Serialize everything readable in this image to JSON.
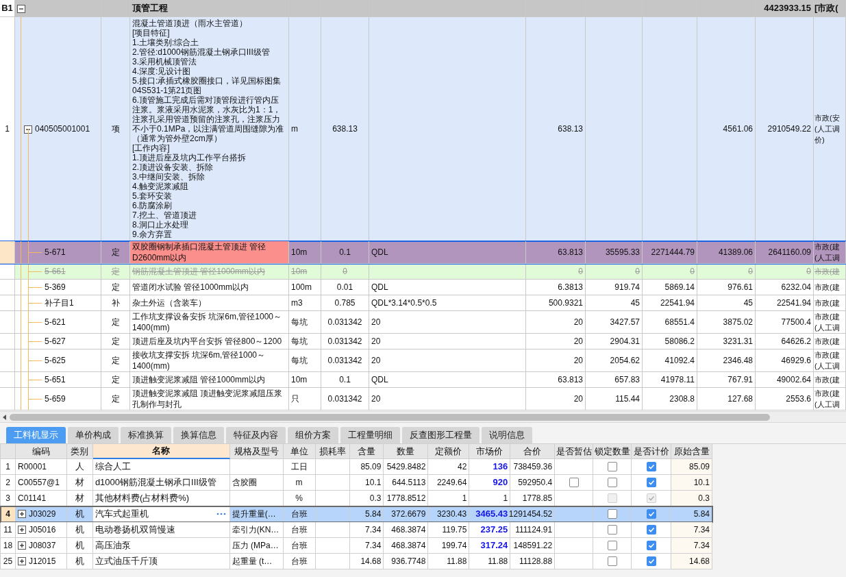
{
  "bill_grid": {
    "rows": [
      {
        "kind": "section",
        "expanded": true,
        "selected": false,
        "struck": false,
        "cells": [
          "B1",
          "",
          "",
          "顶管工程",
          "",
          "",
          "",
          "",
          "",
          "",
          "",
          "4423933.15",
          "[市政("
        ]
      },
      {
        "kind": "item",
        "expanded": true,
        "selected": false,
        "struck": false,
        "cells": [
          "1",
          "040505001001",
          "项",
          [
            "混凝土管道顶进（雨水主管道）",
            "[项目特征]",
            "1.土壤类别:综合土",
            "2.管径:d1000钢筋混凝土钢承口III级管",
            "3.采用机械顶管法",
            "4.深度:见设计图",
            "5.接口:承插式橡胶圈接口，详见国标图集04S531-1第21页图",
            "6.顶管施工完成后需对顶管段进行管内压注浆。浆液采用水泥浆，水灰比为1：1，注浆孔采用管道预留的注浆孔，注浆压力不小于0.1MPa，以注满管道周围缝隙为准（通常为管外壁2cm厚）",
            "[工作内容]",
            "1.顶进后座及坑内工作平台搭拆",
            "2.顶进设备安装、拆除",
            "3.中继间安装、拆除",
            "4.触变泥浆减阻",
            "5.套环安装",
            "6.防腐涂刷",
            "7.挖土、管道顶进",
            "8.洞口止水处理",
            "9.余方弃置"
          ],
          "m",
          "638.13",
          "",
          "638.13",
          "",
          "",
          "4561.06",
          "2910549.22",
          "市政(安(人工调价)"
        ]
      },
      {
        "kind": "sub",
        "selected": true,
        "struck": false,
        "cells": [
          "",
          "5-671",
          "定",
          "双胶圈钢制承插口混凝土管顶进 管径D2600mm以内",
          "10m",
          "0.1",
          "QDL",
          "63.813",
          "35595.33",
          "2271444.79",
          "41389.06",
          "2641160.09",
          "市政(建(人工调"
        ]
      },
      {
        "kind": "sub",
        "selected": false,
        "struck": true,
        "cells": [
          "",
          "5-661",
          "定",
          "钢筋混凝土管顶进 管径1000mm以内",
          "10m",
          "0",
          "",
          "0",
          "0",
          "0",
          "0",
          "0",
          "市政(建"
        ]
      },
      {
        "kind": "sub",
        "selected": false,
        "struck": false,
        "cells": [
          "",
          "5-369",
          "定",
          "管道闭水试验 管径1000mm以内",
          "100m",
          "0.01",
          "QDL",
          "6.3813",
          "919.74",
          "5869.14",
          "976.61",
          "6232.04",
          "市政(建"
        ]
      },
      {
        "kind": "sub",
        "selected": false,
        "struck": false,
        "cells": [
          "",
          "补子目1",
          "补",
          "杂土外运（含装车）",
          "m3",
          "0.785",
          "QDL*3.14*0.5*0.5",
          "500.9321",
          "45",
          "22541.94",
          "45",
          "22541.94",
          "市政(建"
        ]
      },
      {
        "kind": "sub",
        "selected": false,
        "struck": false,
        "cells": [
          "",
          "5-621",
          "定",
          "工作坑支撑设备安拆 坑深6m,管径1000～1400(mm)",
          "每坑",
          "0.031342",
          "20",
          "20",
          "3427.57",
          "68551.4",
          "3875.02",
          "77500.4",
          "市政(建(人工调"
        ]
      },
      {
        "kind": "sub",
        "selected": false,
        "struck": false,
        "cells": [
          "",
          "5-627",
          "定",
          "顶进后座及坑内平台安拆 管径800～1200",
          "每坑",
          "0.031342",
          "20",
          "20",
          "2904.31",
          "58086.2",
          "3231.31",
          "64626.2",
          "市政(建"
        ]
      },
      {
        "kind": "sub",
        "selected": false,
        "struck": false,
        "cells": [
          "",
          "5-625",
          "定",
          "接收坑支撑安拆 坑深6m,管径1000～1400(mm)",
          "每坑",
          "0.031342",
          "20",
          "20",
          "2054.62",
          "41092.4",
          "2346.48",
          "46929.6",
          "市政(建(人工调"
        ]
      },
      {
        "kind": "sub",
        "selected": false,
        "struck": false,
        "cells": [
          "",
          "5-651",
          "定",
          "顶进触变泥浆减阻 管径1000mm以内",
          "10m",
          "0.1",
          "QDL",
          "63.813",
          "657.83",
          "41978.11",
          "767.91",
          "49002.64",
          "市政(建"
        ]
      },
      {
        "kind": "sub",
        "selected": false,
        "struck": false,
        "cells": [
          "",
          "5-659",
          "定",
          "顶进触变泥浆减阻 顶进触变泥浆减阻压浆孔制作与封孔",
          "只",
          "0.031342",
          "20",
          "20",
          "115.44",
          "2308.8",
          "127.68",
          "2553.6",
          "市政(建(人工调"
        ]
      }
    ]
  },
  "tabs": [
    {
      "label": "工料机显示",
      "selected": true
    },
    {
      "label": "单价构成",
      "selected": false
    },
    {
      "label": "标准换算",
      "selected": false
    },
    {
      "label": "换算信息",
      "selected": false
    },
    {
      "label": "特征及内容",
      "selected": false
    },
    {
      "label": "组价方案",
      "selected": false
    },
    {
      "label": "工程量明细",
      "selected": false
    },
    {
      "label": "反查图形工程量",
      "selected": false
    },
    {
      "label": "说明信息",
      "selected": false
    }
  ],
  "resource_table": {
    "columns": [
      {
        "label": "编码",
        "selected": false
      },
      {
        "label": "类别",
        "selected": false
      },
      {
        "label": "名称",
        "selected": true
      },
      {
        "label": "规格及型号",
        "selected": false
      },
      {
        "label": "单位",
        "selected": false
      },
      {
        "label": "损耗率",
        "selected": false
      },
      {
        "label": "含量",
        "selected": false
      },
      {
        "label": "数量",
        "selected": false
      },
      {
        "label": "定额价",
        "selected": false
      },
      {
        "label": "市场价",
        "selected": false
      },
      {
        "label": "合价",
        "selected": false
      },
      {
        "label": "是否暂估",
        "selected": false
      },
      {
        "label": "锁定数量",
        "selected": false
      },
      {
        "label": "是否计价",
        "selected": false
      },
      {
        "label": "原始含量",
        "selected": false
      }
    ],
    "rows": [
      {
        "number": "1",
        "code": "R00001",
        "category": "人",
        "name": "综合人工",
        "spec": "",
        "unit": "工日",
        "loss": "",
        "content": "85.09",
        "quantity": "5429.8482",
        "base_price": "42",
        "market_price": "136",
        "price_adjusted": true,
        "total": "738459.36",
        "locked": false,
        "priced": true,
        "disabled": false,
        "original_content": "85.09",
        "selected": false
      },
      {
        "number": "2",
        "code": "C00557@1",
        "category": "材",
        "name": "d1000钢筋混凝土钢承口III级管",
        "spec": "含胶圈",
        "unit": "m",
        "loss": "",
        "content": "10.1",
        "quantity": "644.5113",
        "base_price": "2249.64",
        "market_price": "920",
        "price_adjusted": true,
        "total": "592950.4",
        "estimated": false,
        "locked": false,
        "priced": true,
        "disabled": false,
        "original_content": "10.1",
        "selected": false
      },
      {
        "number": "3",
        "code": "C01141",
        "category": "材",
        "name": "其他材料费(占材料费%)",
        "spec": "",
        "unit": "%",
        "loss": "",
        "content": "0.3",
        "quantity": "1778.8512",
        "base_price": "1",
        "market_price": "1",
        "price_adjusted": false,
        "total": "1778.85",
        "locked": false,
        "priced": true,
        "disabled": true,
        "original_content": "0.3",
        "selected": false
      },
      {
        "number": "4",
        "expanded": false,
        "code": "J03029",
        "category": "机",
        "name": "汽车式起重机",
        "spec": "提升重量(…",
        "unit": "台班",
        "loss": "",
        "content": "5.84",
        "quantity": "372.6679",
        "base_price": "3230.43",
        "market_price": "3465.43",
        "price_adjusted": true,
        "total": "1291454.52",
        "locked": false,
        "priced": true,
        "disabled": false,
        "original_content": "5.84",
        "selected": true
      },
      {
        "number": "11",
        "expanded": false,
        "code": "J05016",
        "category": "机",
        "name": "电动卷扬机双筒慢速",
        "spec": "牵引力(KN…",
        "unit": "台班",
        "loss": "",
        "content": "7.34",
        "quantity": "468.3874",
        "base_price": "119.75",
        "market_price": "237.25",
        "price_adjusted": true,
        "total": "111124.91",
        "locked": false,
        "priced": true,
        "disabled": false,
        "original_content": "7.34",
        "selected": false
      },
      {
        "number": "18",
        "expanded": false,
        "code": "J08037",
        "category": "机",
        "name": "高压油泵",
        "spec": "压力 (MPa…",
        "unit": "台班",
        "loss": "",
        "content": "7.34",
        "quantity": "468.3874",
        "base_price": "199.74",
        "market_price": "317.24",
        "price_adjusted": true,
        "total": "148591.22",
        "locked": false,
        "priced": true,
        "disabled": false,
        "original_content": "7.34",
        "selected": false
      },
      {
        "number": "25",
        "expanded": false,
        "code": "J12015",
        "category": "机",
        "name": "立式油压千斤顶",
        "spec": "起重量 (t…",
        "unit": "台班",
        "loss": "",
        "content": "14.68",
        "quantity": "936.7748",
        "base_price": "11.88",
        "market_price": "11.88",
        "price_adjusted": false,
        "total": "11128.88",
        "locked": false,
        "priced": true,
        "disabled": false,
        "original_content": "14.68",
        "selected": false
      }
    ]
  }
}
